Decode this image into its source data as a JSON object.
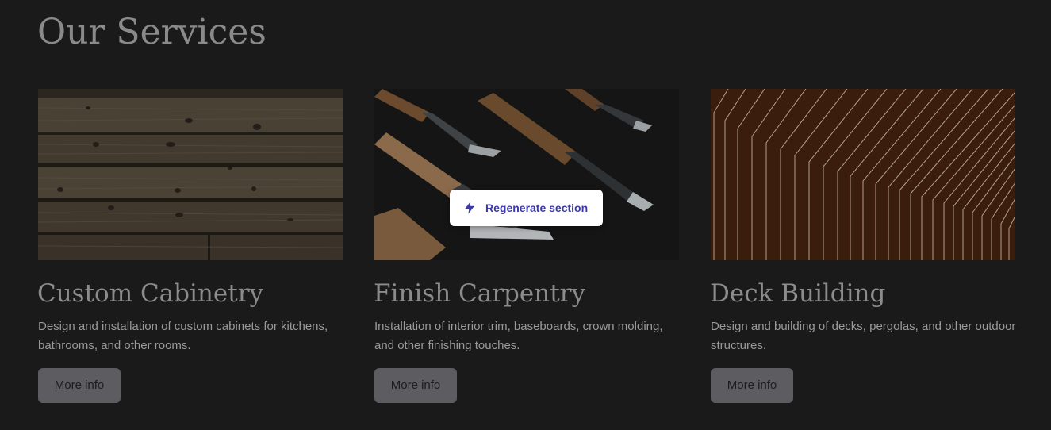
{
  "section": {
    "title": "Our Services"
  },
  "services": [
    {
      "title": "Custom Cabinetry",
      "description": "Design and installation of custom cabinets for kitchens, bathrooms, and other rooms.",
      "button_label": "More info",
      "image": "weathered-wood-planks"
    },
    {
      "title": "Finish Carpentry",
      "description": "Installation of interior trim, baseboards, crown molding, and other finishing touches.",
      "button_label": "More info",
      "image": "wood-chisels"
    },
    {
      "title": "Deck Building",
      "description": "Design and building of decks, pergolas, and other outdoor structures.",
      "button_label": "More info",
      "image": "wood-slat-perspective"
    }
  ],
  "overlay": {
    "regenerate_label": "Regenerate section",
    "icon": "lightning-bolt-icon"
  },
  "colors": {
    "background": "#1a1a1a",
    "heading": "#8a8a8a",
    "body_text": "#9a9a9a",
    "button_bg": "#5d5d61",
    "regenerate_text": "#3c3aa8"
  }
}
